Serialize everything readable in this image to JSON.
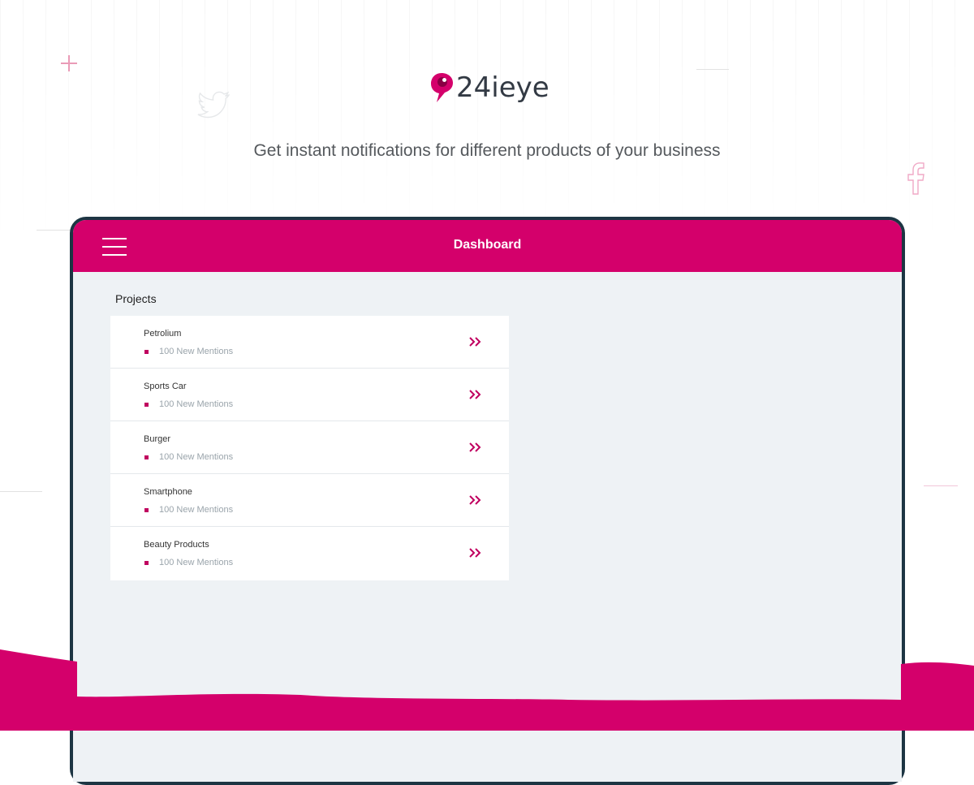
{
  "brand": {
    "name": "24ieye",
    "accent_color": "#d4006b"
  },
  "tagline": "Get instant notifications for different products of your business",
  "decorations": {
    "icons": [
      "plus-icon",
      "twitter-icon",
      "facebook-icon"
    ]
  },
  "app": {
    "header": {
      "title": "Dashboard",
      "menu_icon": "hamburger-icon"
    },
    "projects": {
      "title": "Projects",
      "items": [
        {
          "name": "Petrolium",
          "mentions": "100 New Mentions"
        },
        {
          "name": "Sports Car",
          "mentions": "100 New Mentions"
        },
        {
          "name": "Burger",
          "mentions": "100 New Mentions"
        },
        {
          "name": "Smartphone",
          "mentions": "100 New Mentions"
        },
        {
          "name": "Beauty Products",
          "mentions": "100 New Mentions"
        }
      ],
      "item_icon": "double-chevron-right-icon"
    }
  }
}
